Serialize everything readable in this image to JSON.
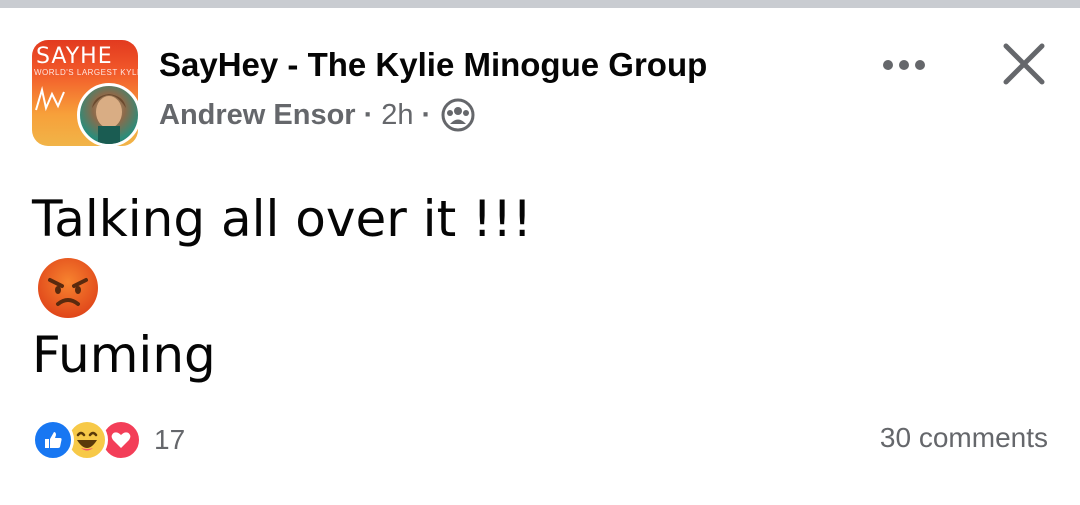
{
  "post": {
    "group_name": "SayHey - The Kylie Minogue Group",
    "author": "Andrew Ensor",
    "separator": "·",
    "time": "2h",
    "audience_icon": "group-icon",
    "avatar": {
      "logo_text": "SAYHE",
      "sub_text": "WORLD'S LARGEST KYLIE F"
    },
    "more_icon": "more-horizontal-icon",
    "close_icon": "close-icon",
    "body": {
      "line1": "Talking all over it !!!",
      "emoji": "angry-face-emoji",
      "line2": "Fuming"
    },
    "reactions": {
      "types": [
        "like",
        "haha",
        "love"
      ],
      "count": "17"
    },
    "comments": "30 comments"
  },
  "colors": {
    "accent": "#1877f2",
    "secondary_text": "#65676b",
    "love": "#f33e58",
    "haha": "#f7c948",
    "angry": "#f05a1e"
  }
}
